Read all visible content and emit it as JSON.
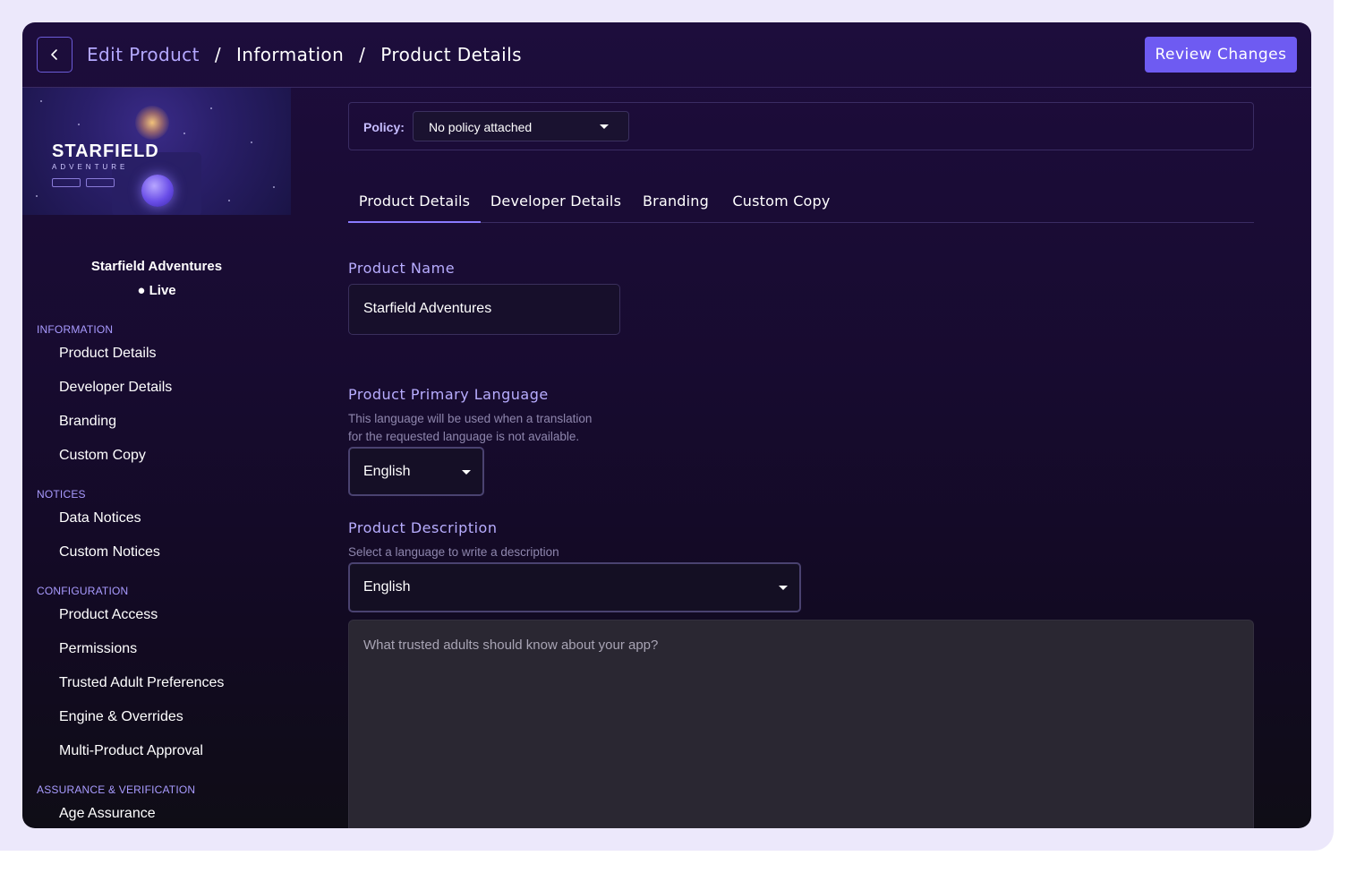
{
  "header": {
    "breadcrumb": [
      "Edit Product",
      "Information",
      "Product Details"
    ],
    "separator": "/",
    "review_label": "Review Changes"
  },
  "sidebar": {
    "image": {
      "title": "STARFIELD",
      "subtitle": "ADVENTURE"
    },
    "product_name": "Starfield Adventures",
    "status": "Live",
    "sections": [
      {
        "label": "INFORMATION",
        "items": [
          "Product Details",
          "Developer Details",
          "Branding",
          "Custom Copy"
        ]
      },
      {
        "label": "NOTICES",
        "items": [
          "Data Notices",
          "Custom Notices"
        ]
      },
      {
        "label": "CONFIGURATION",
        "items": [
          "Product Access",
          "Permissions",
          "Trusted Adult Preferences",
          "Engine & Overrides",
          "Multi-Product Approval"
        ]
      },
      {
        "label": "ASSURANCE & VERIFICATION",
        "items": [
          "Age Assurance"
        ]
      }
    ]
  },
  "main": {
    "policy": {
      "label": "Policy:",
      "value": "No policy attached"
    },
    "tabs": [
      "Product Details",
      "Developer Details",
      "Branding",
      "Custom Copy"
    ],
    "active_tab": "Product Details",
    "product_name": {
      "label": "Product Name",
      "value": "Starfield Adventures"
    },
    "primary_language": {
      "label": "Product Primary Language",
      "helper_lines": [
        "This language will be used when a translation",
        "for the requested language is not available."
      ],
      "value": "English"
    },
    "description": {
      "label": "Product Description",
      "helper": "Select a language to write a description",
      "language": "English",
      "placeholder": "What trusted adults should know about your app?"
    }
  },
  "colors": {
    "accent": "#6e5bf2",
    "label": "#b8adff",
    "background": "#170b2f",
    "frame": "#ece8fb"
  }
}
